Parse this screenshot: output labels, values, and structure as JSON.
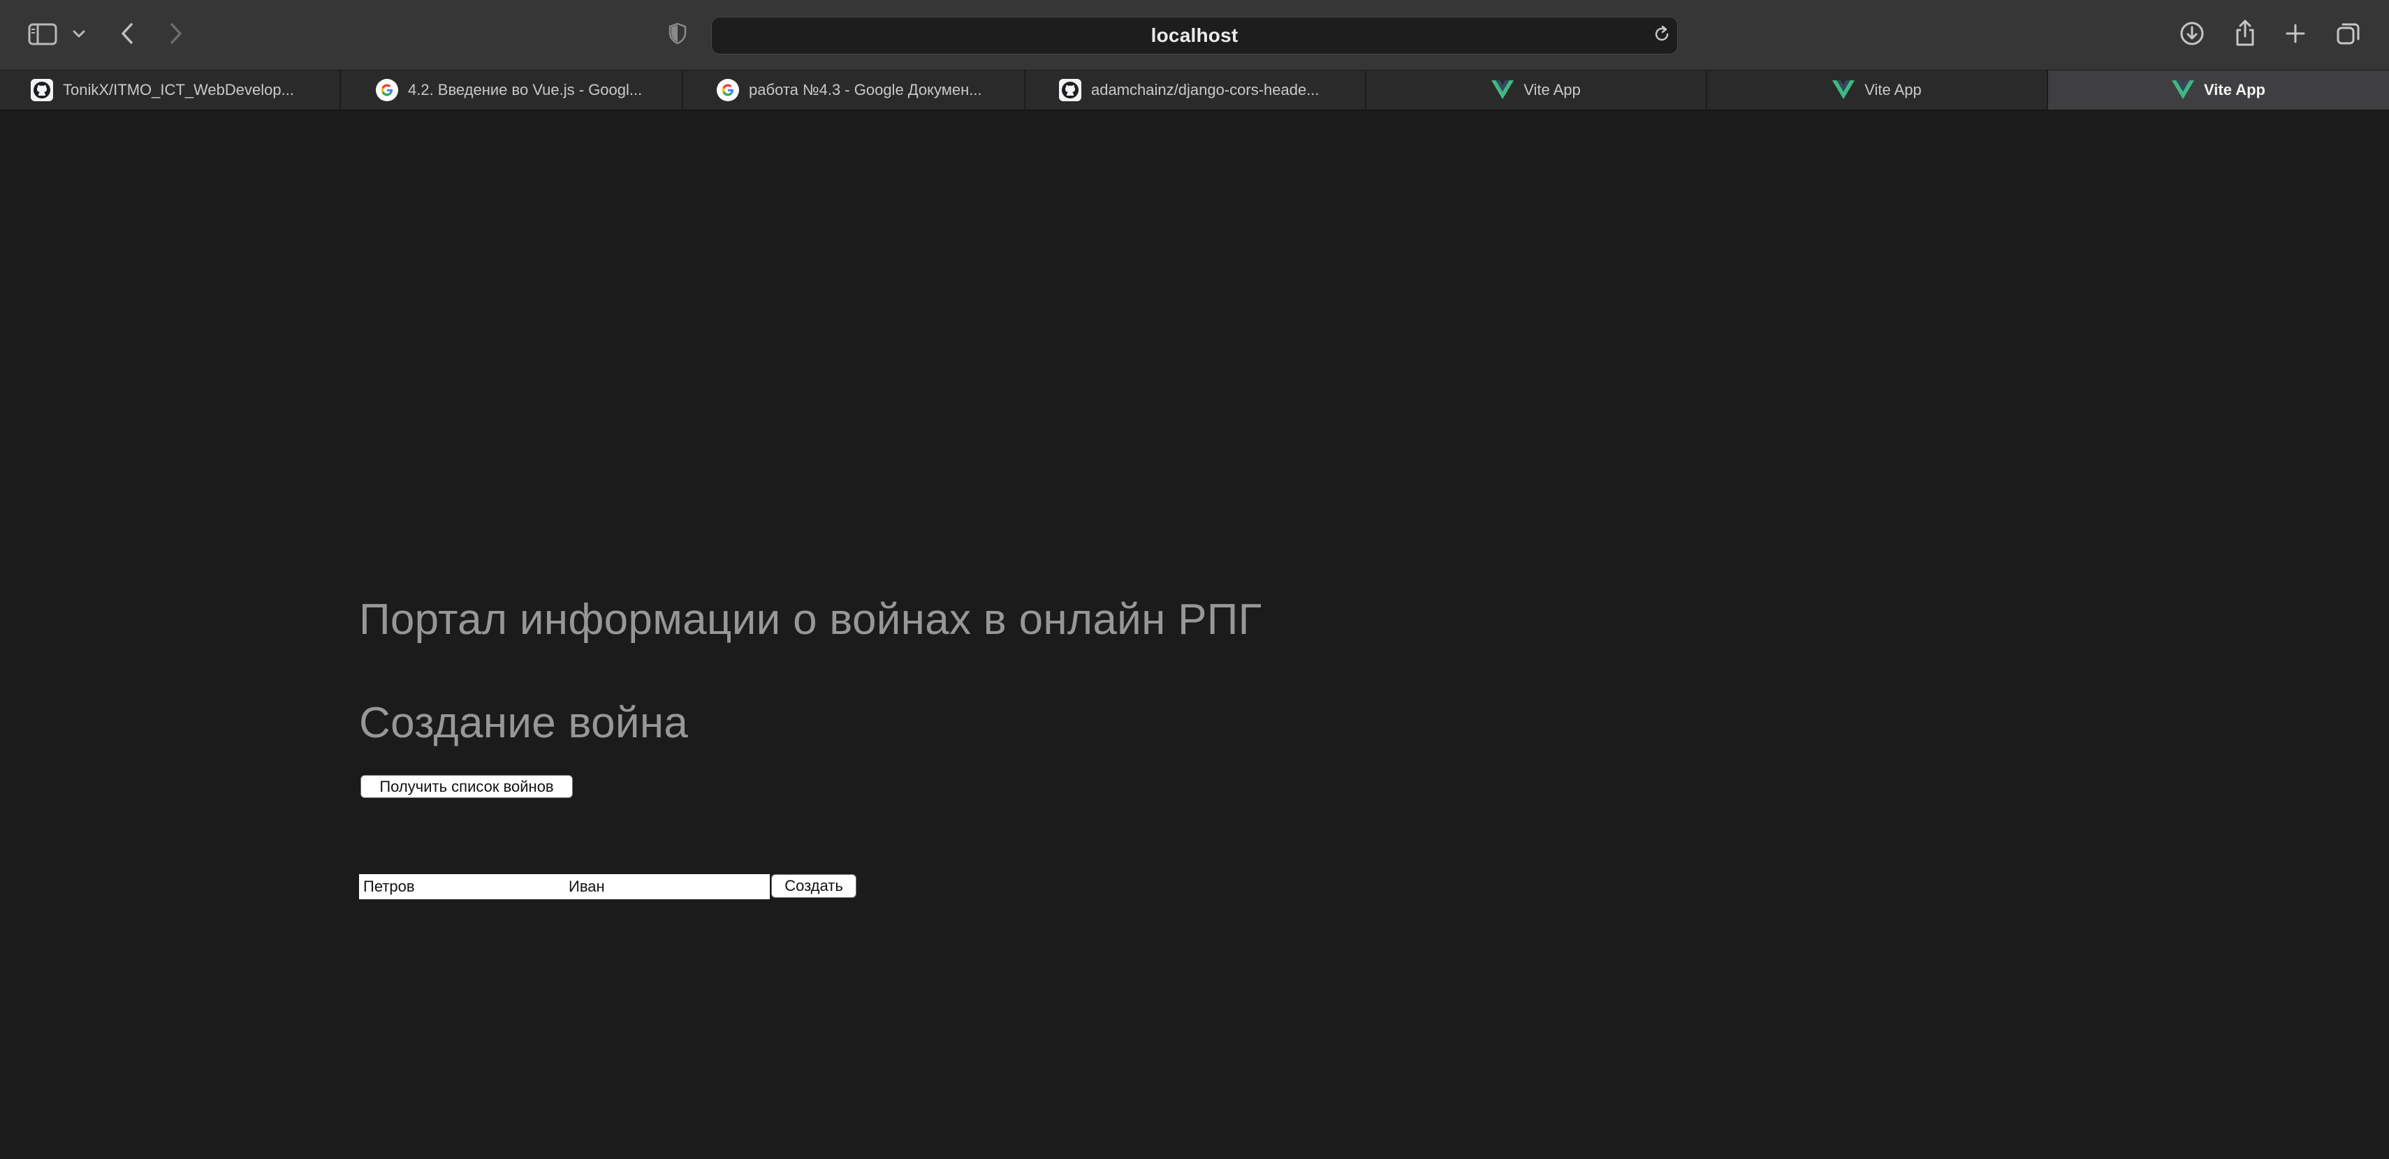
{
  "browser": {
    "address": "localhost",
    "tabs": [
      {
        "label": "TonikX/ITMO_ICT_WebDevelop...",
        "icon": "github-icon",
        "active": false
      },
      {
        "label": "4.2. Введение во Vue.js - Googl...",
        "icon": "google-icon",
        "active": false
      },
      {
        "label": "работа №4.3 - Google Докумен...",
        "icon": "google-icon",
        "active": false
      },
      {
        "label": "adamchainz/django-cors-heade...",
        "icon": "github-icon",
        "active": false
      },
      {
        "label": "Vite App",
        "icon": "vue-icon",
        "active": false
      },
      {
        "label": "Vite App",
        "icon": "vue-icon",
        "active": false
      },
      {
        "label": "Vite App",
        "icon": "vue-icon",
        "active": true
      }
    ]
  },
  "page": {
    "title": "Портал информации о войнах в онлайн РПГ",
    "list_button": "Получить список войнов",
    "create_title": "Создание война",
    "form": {
      "last_name": "Петров",
      "first_name": "Иван",
      "submit": "Создать"
    }
  },
  "colors": {
    "background": "#1b1b1b",
    "toolbar": "#363637",
    "heading": "#979797",
    "vue_green": "#41b883"
  }
}
